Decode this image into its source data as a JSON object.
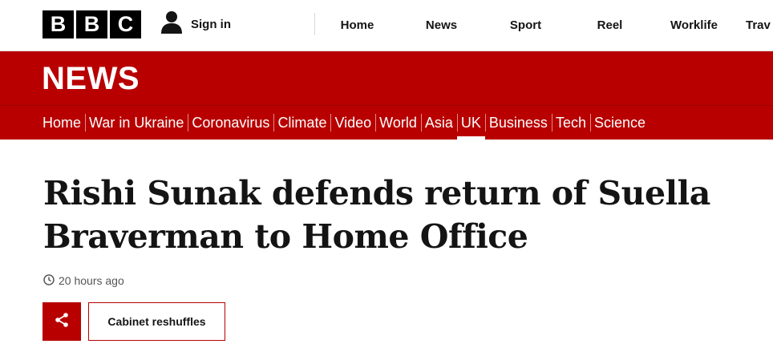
{
  "header": {
    "logo_letters": [
      "B",
      "B",
      "C"
    ],
    "signin_label": "Sign in",
    "signin_icon": "user-icon",
    "nav": [
      "Home",
      "News",
      "Sport",
      "Reel",
      "Worklife",
      "Trav"
    ]
  },
  "banner": {
    "title": "NEWS",
    "color": "#b80000"
  },
  "section_nav": {
    "items": [
      "Home",
      "War in Ukraine",
      "Coronavirus",
      "Climate",
      "Video",
      "World",
      "Asia",
      "UK",
      "Business",
      "Tech",
      "Science"
    ],
    "active": "UK"
  },
  "article": {
    "headline": "Rishi Sunak defends return of Suella Braverman to Home Office",
    "timestamp": "20 hours ago",
    "timestamp_icon": "clock-icon",
    "share_icon": "share-icon",
    "tag": "Cabinet reshuffles"
  }
}
